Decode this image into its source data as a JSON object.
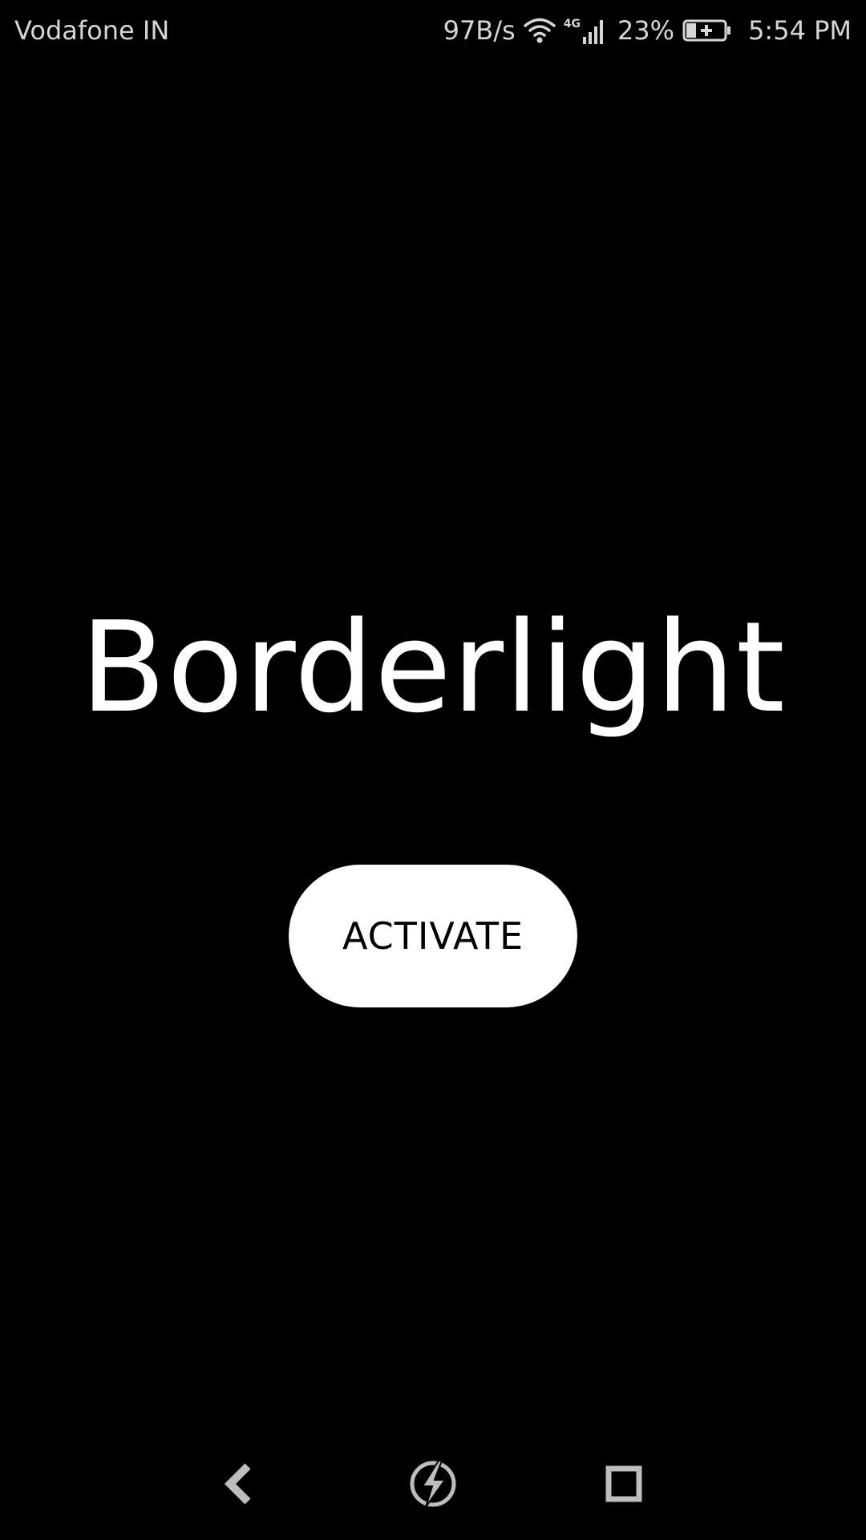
{
  "status_bar": {
    "carrier": "Vodafone IN",
    "net_speed": "97B/s",
    "network_type": "4G",
    "battery_percent": "23%",
    "time": "5:54 PM",
    "icons": [
      "wifi-icon",
      "signal-icon",
      "battery-charging-icon"
    ]
  },
  "main": {
    "title": "Borderlight",
    "activate_label": "ACTIVATE"
  },
  "nav_bar": {
    "icons": [
      "back-icon",
      "home-icon",
      "recents-icon"
    ]
  },
  "colors": {
    "background": "#000000",
    "foreground": "#ffffff",
    "status_text": "#d6d6d6"
  }
}
